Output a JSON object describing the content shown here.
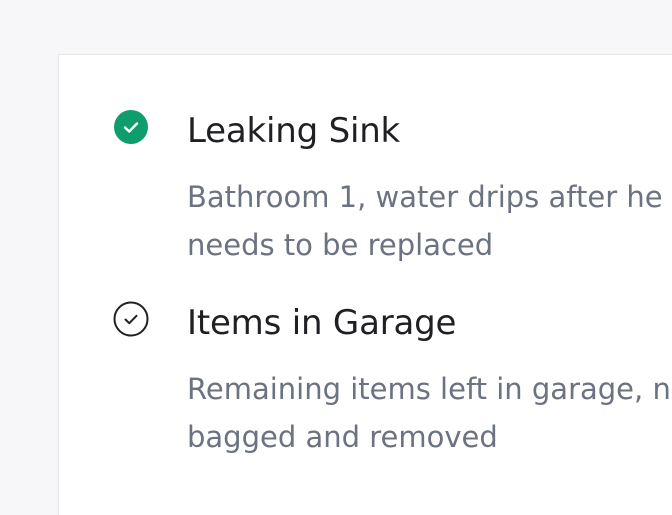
{
  "colors": {
    "page_bg": "#f7f7f9",
    "card_bg": "#ffffff",
    "accent_green": "#0f9d6e",
    "title_text": "#1f2023",
    "desc_text": "#6b7280"
  },
  "tasks": [
    {
      "status": "completed",
      "icon": "check-circle-filled-icon",
      "title": "Leaking Sink",
      "description_line_1": "Bathroom 1, water drips after he",
      "description_line_2": "needs to be replaced"
    },
    {
      "status": "incomplete",
      "icon": "check-circle-outline-icon",
      "title": "Items in Garage",
      "description_line_1": "Remaining items left in garage, n",
      "description_line_2": "bagged and removed"
    }
  ]
}
